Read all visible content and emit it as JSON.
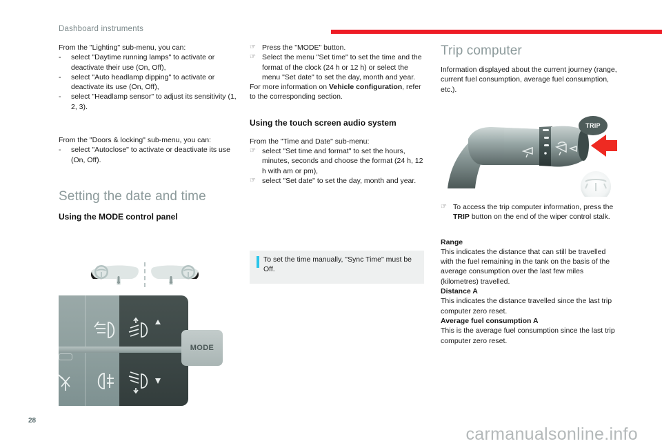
{
  "header": {
    "title": "Dashboard instruments",
    "rule_color": "#ee1c25"
  },
  "columns": {
    "left": {
      "lighting_intro": "From the \"Lighting\" sub-menu, you can:",
      "lighting_items": [
        "select \"Daytime running lamps\" to activate or deactivate their use (On, Off),",
        "select \"Auto headlamp dipping\" to activate or deactivate its use (On, Off),",
        "select \"Headlamp sensor\" to adjust its sensitivity (1, 2, 3)."
      ],
      "doors_intro": "From the \"Doors & locking\" sub-menu, you can:",
      "doors_items": [
        "select \"Autoclose\" to activate or deactivate its use (On, Off)."
      ],
      "section_heading": "Setting the date and time",
      "sub_heading": "Using the MODE control panel",
      "dash_mark": "-"
    },
    "middle": {
      "steps": [
        "Press the \"MODE\" button.",
        "Select the menu \"Set time\" to set the time and the format of the clock (24 h or 12 h) or select the menu \"Set date\" to set the day, month and year."
      ],
      "more_info_pre": "For more information on ",
      "more_info_bold": "Vehicle configuration",
      "more_info_post": ", refer to the corresponding section.",
      "sub_heading": "Using the touch screen audio system",
      "time_date_intro": "From the \"Time and Date\" sub-menu:",
      "time_date_items": [
        "select \"Set time and format\" to set the hours, minutes, seconds and choose the format (24 h, 12 h with am or pm),",
        "select \"Set date\" to set the day, month and year."
      ],
      "note": "To set the time manually, \"Sync Time\" must be Off.",
      "note_accent": "#29c5ea",
      "hand_mark": "☞"
    },
    "right": {
      "section_heading": "Trip computer",
      "intro": "Information displayed about the current journey (range, current fuel consumption, average fuel consumption, etc.).",
      "access_pre": "To access the trip computer information, press the ",
      "access_bold": "TRIP",
      "access_post": " button on the end of the wiper control stalk.",
      "terms": [
        {
          "term": "Range",
          "definition": "This indicates the distance that can still be travelled with the fuel remaining in the tank on the basis of the average consumption over the last few miles (kilometres) travelled."
        },
        {
          "term": "Distance A",
          "definition": "This indicates the distance travelled since the last trip computer zero reset."
        },
        {
          "term": "Average fuel consumption A",
          "definition": "This is the average fuel consumption since the last trip computer zero reset."
        }
      ]
    }
  },
  "figures": {
    "mode_panel": {
      "mode_label": "MODE",
      "icons": [
        "front-fog-lamp-icon",
        "rear-fog-lamp-icon",
        "headlamp-beam-up-icon",
        "headlamp-beam-down-icon",
        "lighting-dimmer-icon"
      ],
      "wheel_left": "left-hand-drive-icon",
      "wheel_right": "right-hand-drive-icon",
      "panel_light_color": "#8fa09f",
      "panel_dark_color": "#3c4746"
    },
    "wiper_stalk": {
      "trip_label": "TRIP",
      "arrow_color": "#ee2a22",
      "badge_color": "#4e5c5a",
      "icons": [
        "wiper-icon",
        "windscreen-wash-icon",
        "rear-wiper-icon",
        "steering-wheel-icon"
      ]
    }
  },
  "footer": {
    "page_number": "28",
    "watermark": "carmanualsonline.info"
  }
}
